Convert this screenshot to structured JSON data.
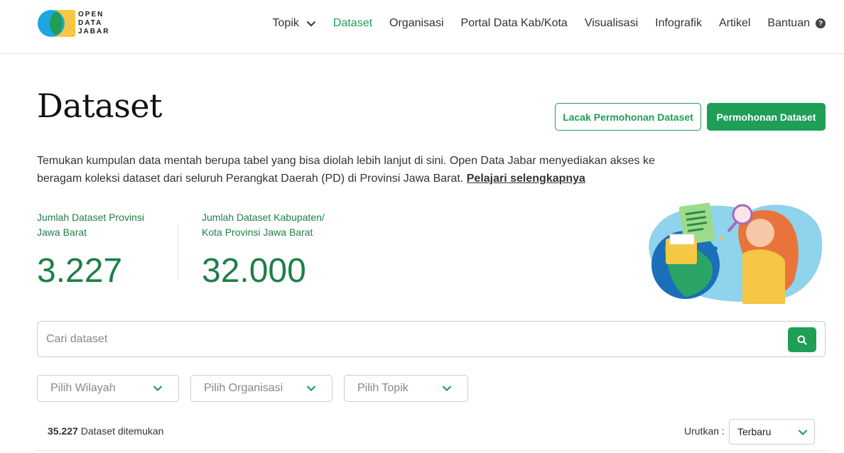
{
  "brand": {
    "logo_line1": "OPEN",
    "logo_line2": "DATA",
    "logo_line3": "JABAR"
  },
  "nav": {
    "items": [
      {
        "label": "Topik",
        "has_dropdown": true
      },
      {
        "label": "Dataset",
        "active": true
      },
      {
        "label": "Organisasi"
      },
      {
        "label": "Portal Data Kab/Kota"
      },
      {
        "label": "Visualisasi"
      },
      {
        "label": "Infografik"
      },
      {
        "label": "Artikel"
      },
      {
        "label": "Bantuan",
        "icon": "help-circle-icon"
      }
    ]
  },
  "page": {
    "title": "Dataset",
    "btn_track": "Lacak Permohonan Dataset",
    "btn_request": "Permohonan Dataset",
    "description": "Temukan kumpulan data mentah berupa tabel yang bisa diolah lebih lanjut di sini. Open Data Jabar menyediakan akses ke beragam koleksi dataset dari seluruh Perangkat Daerah (PD) di Provinsi Jawa Barat.",
    "learn_more": "Pelajari selengkapnya"
  },
  "stats": {
    "province_label_1": "Jumlah Dataset Provinsi",
    "province_label_2": "Jawa Barat",
    "province_value": "3.227",
    "kabkota_label_1": "Jumlah Dataset Kabupaten/",
    "kabkota_label_2": "Kota Provinsi Jawa Barat",
    "kabkota_value": "32.000"
  },
  "search": {
    "placeholder": "Cari dataset",
    "value": ""
  },
  "filters": {
    "wilayah": "Pilih Wilayah",
    "organisasi": "Pilih Organisasi",
    "topik": "Pilih Topik"
  },
  "results": {
    "count": "35.227",
    "suffix": "Dataset ditemukan",
    "sort_label": "Urutkan :",
    "sort_value": "Terbaru"
  },
  "colors": {
    "primary": "#1e9e56",
    "stat_text": "#1e7f47",
    "logo_blue": "#1fa6e0",
    "logo_yellow": "#f6c744",
    "logo_green": "#1e9e56"
  }
}
